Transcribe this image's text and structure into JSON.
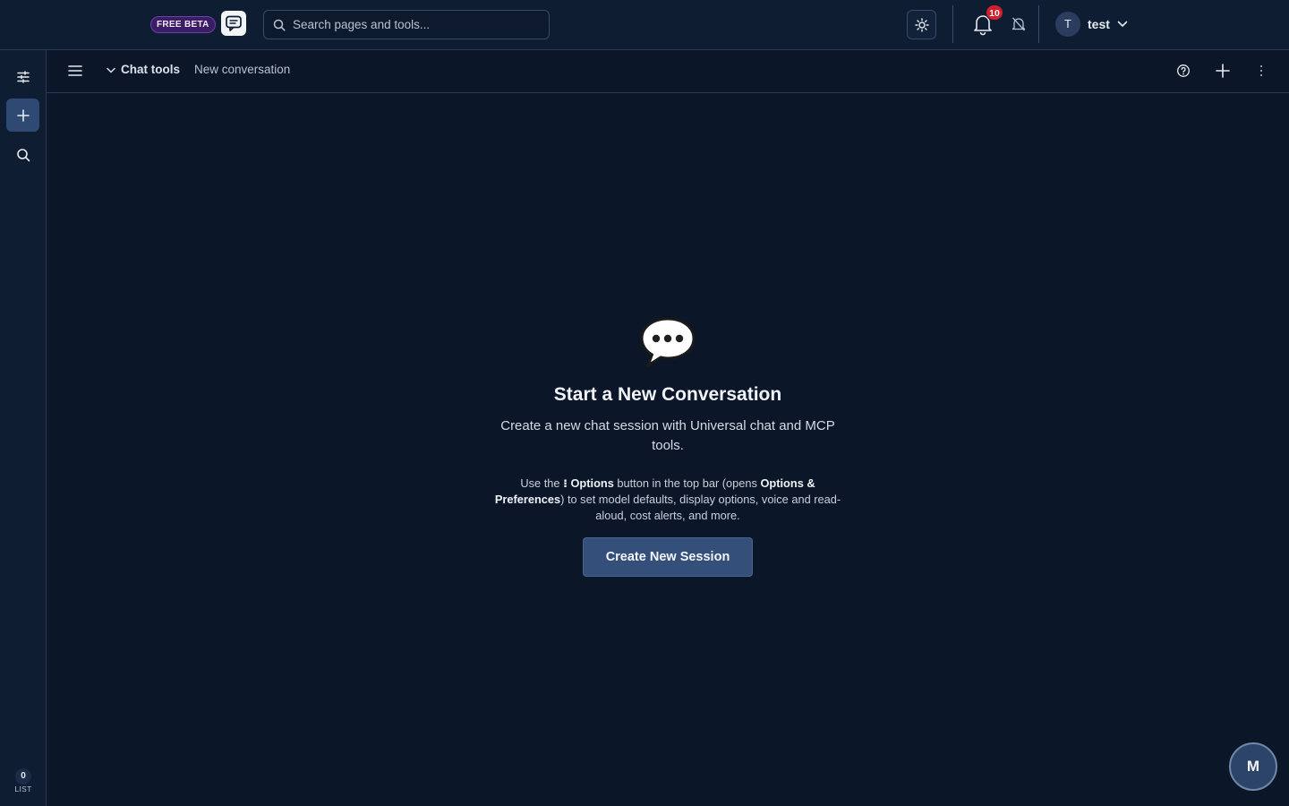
{
  "header": {
    "beta_label": "FREE BETA",
    "search_placeholder": "Search pages and tools...",
    "notification_count": "10",
    "user_initial": "T",
    "user_name": "test"
  },
  "rail": {
    "list_count": "0",
    "list_label": "LIST"
  },
  "subheader": {
    "breadcrumb_main": "Chat tools",
    "breadcrumb_sub": "New conversation"
  },
  "empty_state": {
    "title": "Start a New Conversation",
    "description": "Create a new chat session with Universal chat and MCP tools.",
    "hint_prefix": "Use the ",
    "hint_options": "⁝ Options",
    "hint_mid": " button in the top bar (opens ",
    "hint_prefs": "Options & Preferences",
    "hint_suffix": ") to set model defaults, display options, voice and read-aloud, cost alerts, and more.",
    "button_label": "Create New Session"
  },
  "fab_label": "M",
  "colors": {
    "background": "#0b1628",
    "panel": "#0f1d33",
    "accent_button": "#34507a",
    "badge_red": "#d21f2c",
    "beta_purple": "#3b1d63"
  }
}
